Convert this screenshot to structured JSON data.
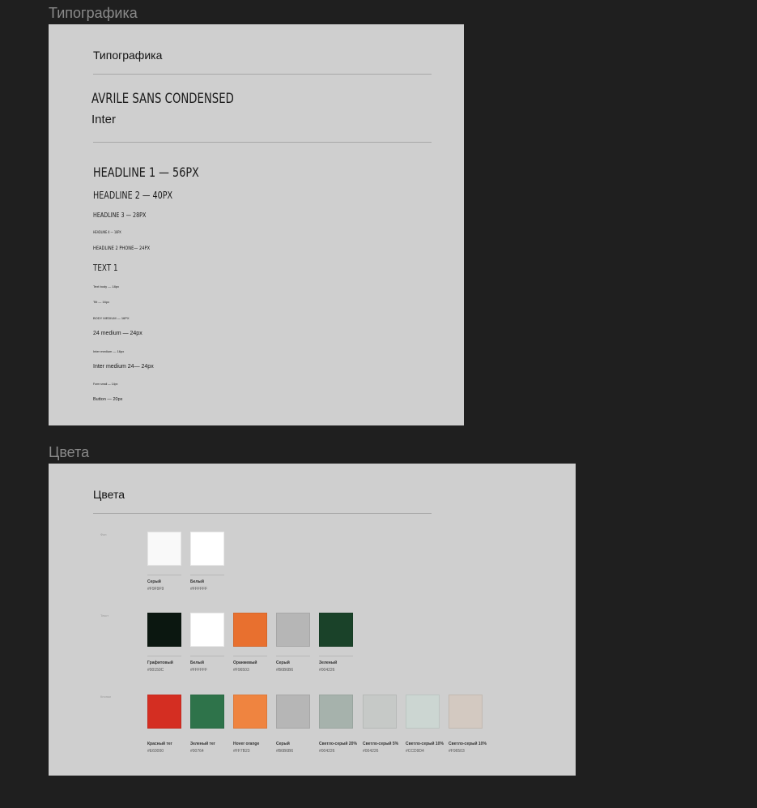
{
  "typography": {
    "frame_label": "Типографика",
    "title": "Типографика",
    "fonts": [
      "AVRILE SANS CONDENSED",
      "Inter"
    ],
    "styles": [
      "HEADLINE 1 — 56PX",
      "HEADLINE 2 — 40PX",
      "HEADLINE 3 — 28PX",
      "HEADLINE 4 — 18PX",
      "HEADLINE 2 PHONE— 24PX",
      "TEXT 1",
      "Text body — 18px",
      "Tilt — 16px",
      "BODY MEDIUM — 16PX",
      "24 medium — 24px",
      "Inter medium — 16px",
      "Inter medium 24— 24px",
      "Form small — 14px",
      "Button — 20px"
    ]
  },
  "colors": {
    "frame_label": "Цвета",
    "title": "Цвета",
    "rows": [
      {
        "label": "Фон",
        "swatches": [
          {
            "name": "Серый",
            "hex": "#F9F9F9",
            "color": "#F9F9F9"
          },
          {
            "name": "Белый",
            "hex": "#FFFFFF",
            "color": "#FFFFFF"
          }
        ]
      },
      {
        "label": "Текст",
        "swatches": [
          {
            "name": "Графитовый",
            "hex": "#00150C",
            "color": "#0B1710"
          },
          {
            "name": "Белый",
            "hex": "#FFFFFF",
            "color": "#FFFFFF"
          },
          {
            "name": "Оранжевый",
            "hex": "#F96503",
            "color": "#E8702F"
          },
          {
            "name": "Серый",
            "hex": "#B6B6B6",
            "color": "#B6B6B6"
          },
          {
            "name": "Зеленый",
            "hex": "#004226",
            "color": "#1A4229"
          }
        ]
      },
      {
        "label": "Кнопки",
        "swatches": [
          {
            "name": "Красный тег",
            "hex": "#E60000",
            "color": "#D42E22"
          },
          {
            "name": "Зеленый тег",
            "hex": "#00764",
            "color": "#2E734A"
          },
          {
            "name": "Hover orange",
            "hex": "#FF7B23",
            "color": "#EF8440"
          },
          {
            "name": "Серый",
            "hex": "#B6B6B6",
            "color": "#B6B6B6"
          },
          {
            "name": "Светло-серый 20%",
            "hex": "#004226",
            "color": "#A6B2AC"
          },
          {
            "name": "Светло-серый 5%",
            "hex": "#004226",
            "color": "#C6C9C7"
          },
          {
            "name": "Светло-серый 10%",
            "hex": "#CCD9D4",
            "color": "#CCD6D2"
          },
          {
            "name": "Светло-серый 10%",
            "hex": "#F96503",
            "color": "#D3C9C1"
          }
        ]
      }
    ]
  }
}
